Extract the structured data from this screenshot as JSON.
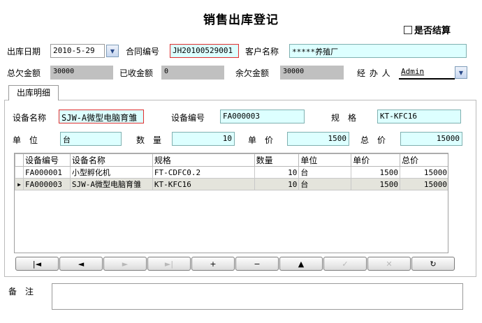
{
  "title": "销售出库登记",
  "settle_checkbox": {
    "label": "是否结算",
    "checked": false
  },
  "header": {
    "date": {
      "label": "出库日期",
      "value": "2010-5-29"
    },
    "contract_no": {
      "label": "合同编号",
      "value": "JH20100529001"
    },
    "customer": {
      "label": "客户名称",
      "value": "*****养殖厂"
    },
    "total_owed": {
      "label": "总欠金额",
      "value": "30000"
    },
    "received": {
      "label": "已收金额",
      "value": "0"
    },
    "balance": {
      "label": "余欠金额",
      "value": "30000"
    },
    "handler": {
      "label": "经 办 人",
      "value": "Admin"
    }
  },
  "tab_label": "出库明细",
  "detail": {
    "equip_name": {
      "label": "设备名称",
      "value": "SJW-A微型电脑育雏"
    },
    "equip_no": {
      "label": "设备编号",
      "value": "FA000003"
    },
    "spec": {
      "label": "规　格",
      "value": "KT-KFC16"
    },
    "unit": {
      "label": "单　位",
      "value": "台"
    },
    "qty": {
      "label": "数　量",
      "value": "10"
    },
    "price": {
      "label": "单　价",
      "value": "1500"
    },
    "total": {
      "label": "总　价",
      "value": "15000"
    }
  },
  "grid": {
    "columns": [
      "设备编号",
      "设备名称",
      "规格",
      "数量",
      "单位",
      "单价",
      "总价"
    ],
    "rows": [
      [
        "FA000001",
        "小型孵化机",
        "FT-CDFC0.2",
        "10",
        "台",
        "1500",
        "15000"
      ],
      [
        "FA000003",
        "SJW-A微型电脑育雏",
        "KT-KFC16",
        "10",
        "台",
        "1500",
        "15000"
      ]
    ],
    "selected_row": 1
  },
  "nav_buttons": [
    {
      "name": "first-record-button",
      "glyph": "|◄",
      "enabled": true
    },
    {
      "name": "prev-record-button",
      "glyph": "◄",
      "enabled": true
    },
    {
      "name": "next-record-button",
      "glyph": "►",
      "enabled": false
    },
    {
      "name": "last-record-button",
      "glyph": "►|",
      "enabled": false
    },
    {
      "name": "add-record-button",
      "glyph": "+",
      "enabled": true
    },
    {
      "name": "delete-record-button",
      "glyph": "−",
      "enabled": true
    },
    {
      "name": "edit-record-button",
      "glyph": "▲",
      "enabled": true
    },
    {
      "name": "post-record-button",
      "glyph": "✓",
      "enabled": false
    },
    {
      "name": "cancel-edit-button",
      "glyph": "✕",
      "enabled": false
    },
    {
      "name": "refresh-button",
      "glyph": "↻",
      "enabled": true
    }
  ],
  "memo": {
    "label": "备　注",
    "value": ""
  }
}
